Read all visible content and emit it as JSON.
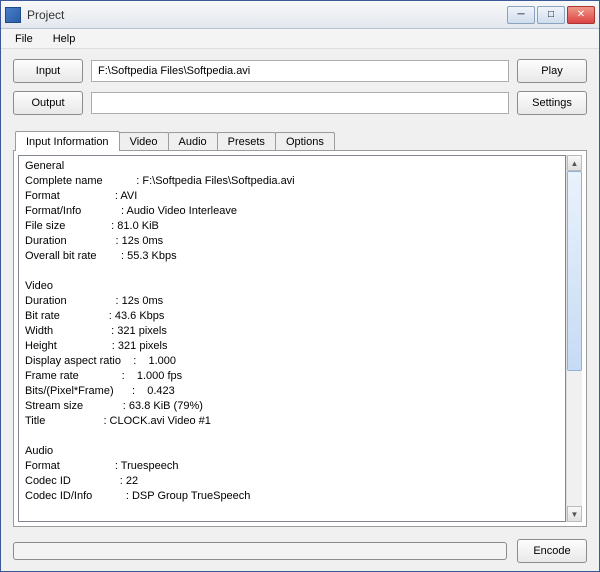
{
  "window": {
    "title": "Project"
  },
  "menu": {
    "file": "File",
    "help": "Help"
  },
  "buttons": {
    "input": "Input",
    "output": "Output",
    "play": "Play",
    "settings": "Settings",
    "encode": "Encode"
  },
  "fields": {
    "input_value": "F:\\Softpedia Files\\Softpedia.avi",
    "output_value": ""
  },
  "tabs": {
    "input_information": "Input Information",
    "video": "Video",
    "audio": "Audio",
    "presets": "Presets",
    "options": "Options"
  },
  "info": {
    "general_header": "General",
    "complete_name_label": "Complete name",
    "complete_name_value": "F:\\Softpedia Files\\Softpedia.avi",
    "format_label": "Format",
    "format_value": "AVI",
    "format_info_label": "Format/Info",
    "format_info_value": "Audio Video Interleave",
    "file_size_label": "File size",
    "file_size_value": "81.0 KiB",
    "duration_label": "Duration",
    "duration_value": "12s 0ms",
    "overall_bitrate_label": "Overall bit rate",
    "overall_bitrate_value": "55.3 Kbps",
    "video_header": "Video",
    "v_duration_label": "Duration",
    "v_duration_value": "12s 0ms",
    "v_bitrate_label": "Bit rate",
    "v_bitrate_value": "43.6 Kbps",
    "v_width_label": "Width",
    "v_width_value": "321 pixels",
    "v_height_label": "Height",
    "v_height_value": "321 pixels",
    "v_dar_label": "Display aspect ratio",
    "v_dar_value": "1.000",
    "v_framerate_label": "Frame rate",
    "v_framerate_value": "1.000 fps",
    "v_bpp_label": "Bits/(Pixel*Frame)",
    "v_bpp_value": "0.423",
    "v_stream_label": "Stream size",
    "v_stream_value": "63.8 KiB (79%)",
    "v_title_label": "Title",
    "v_title_value": "CLOCK.avi Video #1",
    "audio_header": "Audio",
    "a_format_label": "Format",
    "a_format_value": "Truespeech",
    "a_codec_label": "Codec ID",
    "a_codec_value": "22",
    "a_codecinfo_label": "Codec ID/Info",
    "a_codecinfo_value": "DSP Group TrueSpeech"
  }
}
